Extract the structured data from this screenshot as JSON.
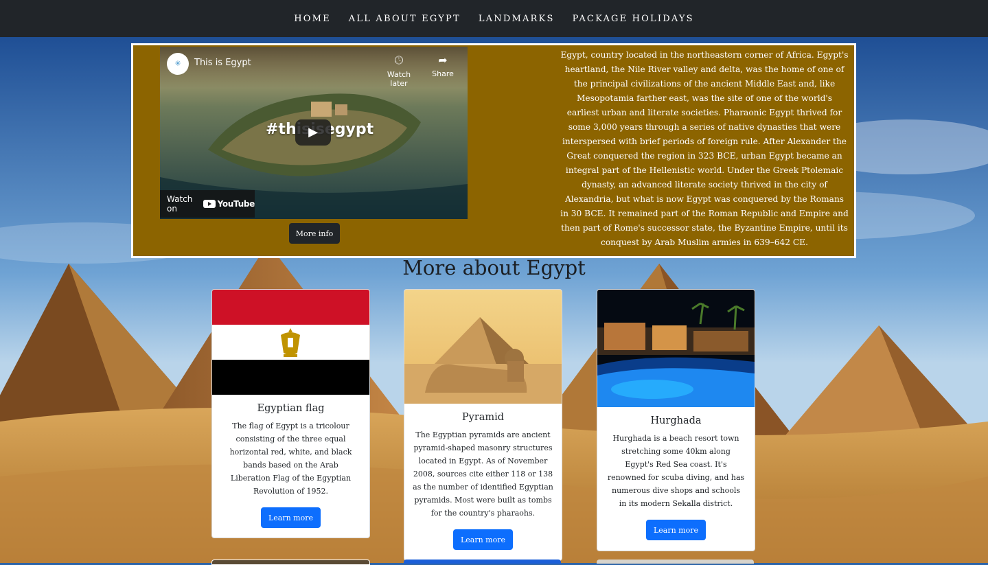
{
  "nav": {
    "items": [
      {
        "label": "HOME"
      },
      {
        "label": "ALL ABOUT EGYPT"
      },
      {
        "label": "LANDMARKS"
      },
      {
        "label": "PACKAGE HOLIDAYS"
      }
    ]
  },
  "intro": {
    "video": {
      "title": "This is Egypt",
      "watch_later": "Watch later",
      "share": "Share",
      "overlay_text": "#thisisegypt",
      "watch_on": "Watch on",
      "youtube": "YouTube"
    },
    "more_info_label": "More info",
    "text": "Egypt, country located in the northeastern corner of Africa. Egypt's heartland, the Nile River valley and delta, was the home of one of the principal civilizations of the ancient Middle East and, like Mesopotamia farther east, was the site of one of the world's earliest urban and literate societies. Pharaonic Egypt thrived for some 3,000 years through a series of native dynasties that were interspersed with brief periods of foreign rule. After Alexander the Great conquered the region in 323 BCE, urban Egypt became an integral part of the Hellenistic world. Under the Greek Ptolemaic dynasty, an advanced literate society thrived in the city of Alexandria, but what is now Egypt was conquered by the Romans in 30 BCE. It remained part of the Roman Republic and Empire and then part of Rome's successor state, the Byzantine Empire, until its conquest by Arab Muslim armies in 639–642 CE."
  },
  "section_title": "More about Egypt",
  "cards": [
    {
      "title": "Egyptian flag",
      "text": "The flag of Egypt is a tricolour consisting of the three equal horizontal red, white, and black bands based on the Arab Liberation Flag of the Egyptian Revolution of 1952.",
      "button": "Learn more"
    },
    {
      "title": "Pyramid",
      "text": "The Egyptian pyramids are ancient pyramid-shaped masonry structures located in Egypt. As of November 2008, sources cite either 118 or 138 as the number of identified Egyptian pyramids. Most were built as tombs for the country's pharaohs.",
      "button": "Learn more"
    },
    {
      "title": "Hurghada",
      "text": "Hurghada is a beach resort town stretching some 40km along Egypt's Red Sea coast. It's renowned for scuba diving, and has numerous dive shops and schools in its modern Sekalla district.",
      "button": "Learn more"
    }
  ],
  "colors": {
    "navbar": "#212529",
    "intro_bg": "#8c6400",
    "primary_button": "#0d6efd",
    "flag_red": "#ce1126",
    "flag_black": "#000000"
  }
}
